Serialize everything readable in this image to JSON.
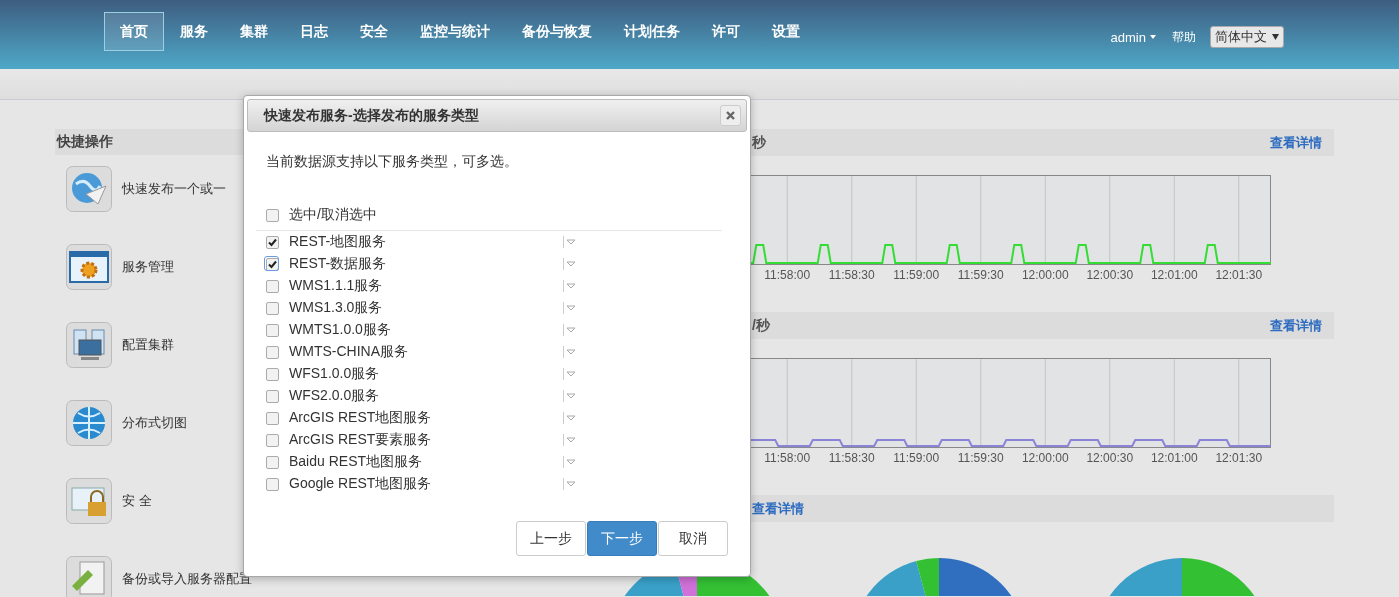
{
  "nav": {
    "items": [
      {
        "label": "首页",
        "selected": true
      },
      {
        "label": "服务",
        "selected": false
      },
      {
        "label": "集群",
        "selected": false
      },
      {
        "label": "日志",
        "selected": false
      },
      {
        "label": "安全",
        "selected": false
      },
      {
        "label": "监控与统计",
        "selected": false
      },
      {
        "label": "备份与恢复",
        "selected": false
      },
      {
        "label": "计划任务",
        "selected": false
      },
      {
        "label": "许可",
        "selected": false
      },
      {
        "label": "设置",
        "selected": false
      }
    ],
    "user": "admin",
    "help": "帮助",
    "language": "简体中文"
  },
  "quick_actions": {
    "title": "快捷操作",
    "items": [
      {
        "label": "快速发布一个或一"
      },
      {
        "label": "服务管理"
      },
      {
        "label": "配置集群"
      },
      {
        "label": "分布式切图"
      },
      {
        "label": "安 全"
      },
      {
        "label": "备份或导入服务器配置"
      }
    ]
  },
  "panels": [
    {
      "kind": "line",
      "title": "秒",
      "link": "查看详情",
      "color": "#33dd33",
      "x_labels": [
        "11:58:00",
        "11:58:30",
        "11:59:00",
        "11:59:30",
        "12:00:00",
        "12:00:30",
        "12:01:00",
        "12:01:30"
      ]
    },
    {
      "kind": "line",
      "title": "/秒",
      "link": "查看详情",
      "color": "#8a84d8",
      "x_labels": [
        "11:58:00",
        "11:58:30",
        "11:59:00",
        "11:59:30",
        "12:00:00",
        "12:00:30",
        "12:01:00",
        "12:01:30"
      ]
    },
    {
      "kind": "pie",
      "link": "查看详情"
    }
  ],
  "dialog": {
    "title": "快速发布服务-选择发布的服务类型",
    "description": "当前数据源支持以下服务类型，可多选。",
    "select_all": {
      "label": "选中/取消选中",
      "checked": false
    },
    "options": [
      {
        "label": "REST-地图服务",
        "checked": true,
        "focused": false
      },
      {
        "label": "REST-数据服务",
        "checked": true,
        "focused": true
      },
      {
        "label": "WMS1.1.1服务",
        "checked": false,
        "focused": false
      },
      {
        "label": "WMS1.3.0服务",
        "checked": false,
        "focused": false
      },
      {
        "label": "WMTS1.0.0服务",
        "checked": false,
        "focused": false
      },
      {
        "label": "WMTS-CHINA服务",
        "checked": false,
        "focused": false
      },
      {
        "label": "WFS1.0.0服务",
        "checked": false,
        "focused": false
      },
      {
        "label": "WFS2.0.0服务",
        "checked": false,
        "focused": false
      },
      {
        "label": "ArcGIS REST地图服务",
        "checked": false,
        "focused": false
      },
      {
        "label": "ArcGIS REST要素服务",
        "checked": false,
        "focused": false
      },
      {
        "label": "Baidu REST地图服务",
        "checked": false,
        "focused": false
      },
      {
        "label": "Google REST地图服务",
        "checked": false,
        "focused": false
      }
    ],
    "buttons": [
      {
        "label": "上一步",
        "kind": "default"
      },
      {
        "label": "下一步",
        "kind": "primary"
      },
      {
        "label": "取消",
        "kind": "default"
      }
    ]
  }
}
